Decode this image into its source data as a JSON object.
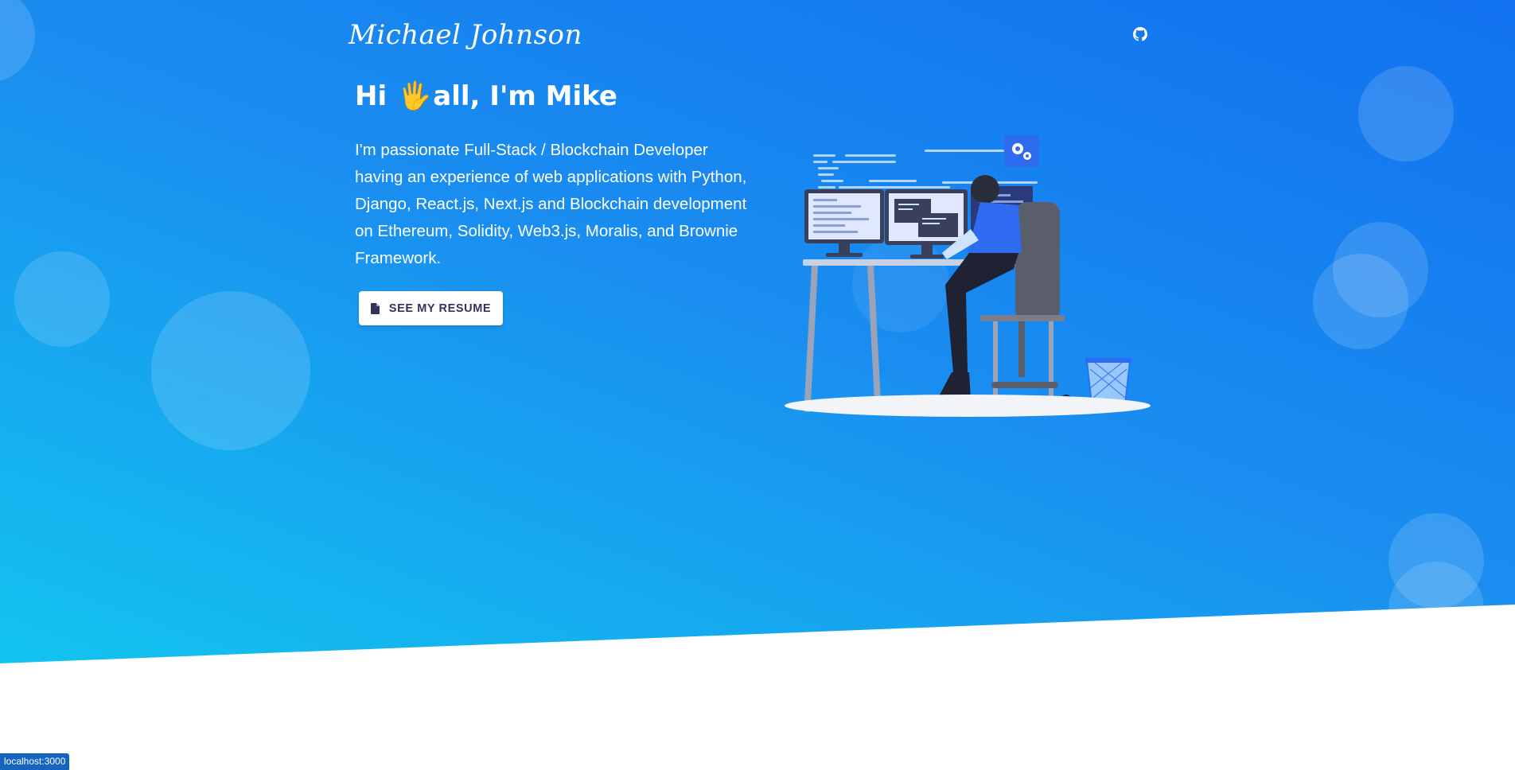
{
  "brand": {
    "name": "Michael Johnson"
  },
  "nav": {
    "github_icon": "github-icon"
  },
  "hero": {
    "greeting_before": "Hi",
    "greeting_emoji": "🖐",
    "greeting_after": "all, I'm Mike",
    "bio": "I'm passionate Full-Stack / Blockchain Developer having an experience of web applications with Python, Django, React.js, Next.js and Blockchain development on Ethereum, Solidity, Web3.js, Moralis, and Brownie Framework.",
    "resume_button": {
      "label": "SEE MY RESUME",
      "icon": "file-icon"
    },
    "illustration": "developer-at-desk-illustration"
  },
  "colors": {
    "gradient_start": "#11cdef",
    "gradient_end": "#1171ef",
    "button_text": "#32325d"
  },
  "status_bar": {
    "url": "localhost:3000"
  }
}
